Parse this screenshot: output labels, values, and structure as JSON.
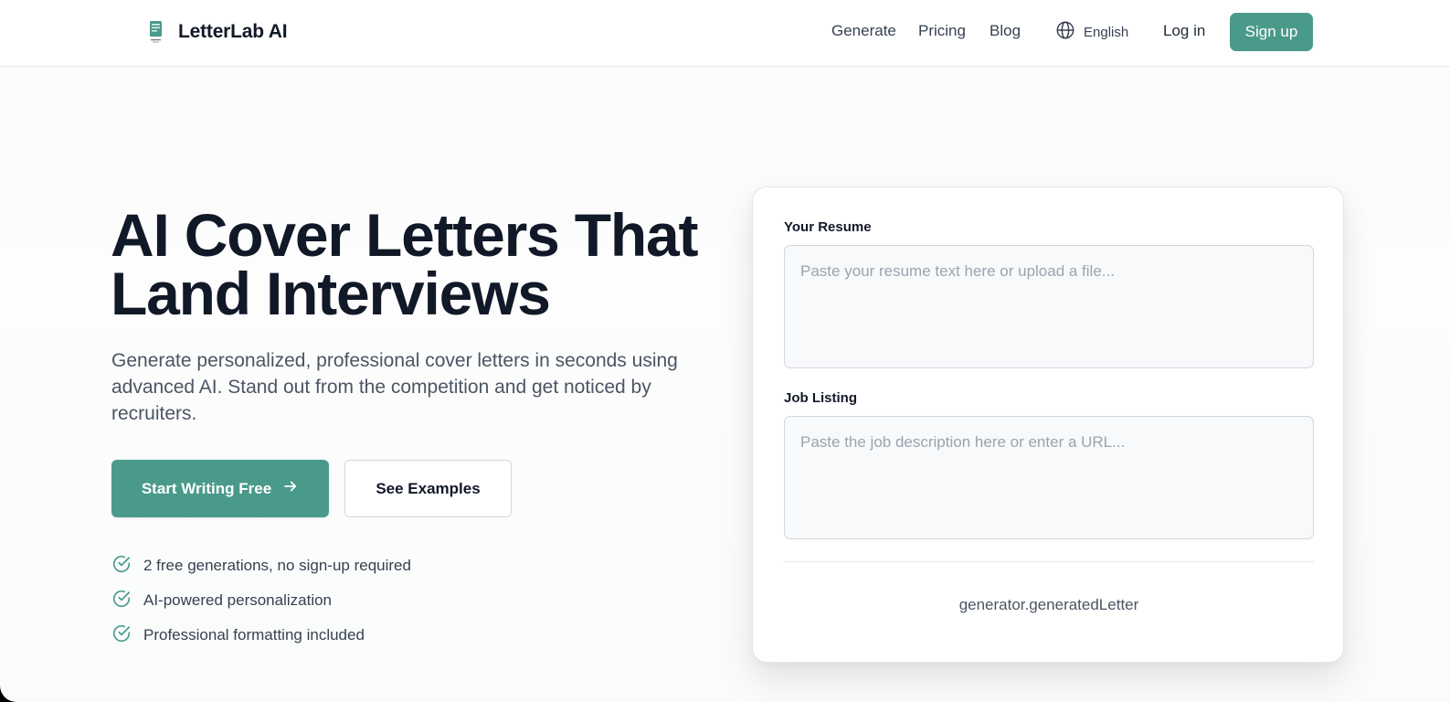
{
  "nav": {
    "brand": "LetterLab AI",
    "links": [
      "Generate",
      "Pricing",
      "Blog"
    ],
    "language": "English",
    "login_label": "Log in",
    "signup_label": "Sign up"
  },
  "hero": {
    "title_line1": "AI Cover Letters That",
    "title_line2": "Land Interviews",
    "subtitle": "Generate personalized, professional cover letters in seconds using advanced AI. Stand out from the competition and get noticed by recruiters.",
    "primary_cta": "Start Writing Free",
    "secondary_cta": "See Examples",
    "features": [
      "2 free generations, no sign-up required",
      "AI-powered personalization",
      "Professional formatting included"
    ]
  },
  "generator": {
    "resume_label": "Your Resume",
    "resume_placeholder": "Paste your resume text here or upload a file...",
    "resume_value": "",
    "job_label": "Job Listing",
    "job_placeholder": "Paste the job description here or enter a URL...",
    "job_value": "",
    "output_text": "generator.generatedLetter"
  },
  "colors": {
    "accent": "#4a9a8c",
    "text": "#111827",
    "muted": "#4b5563",
    "border": "#d1d5db"
  },
  "icons": {
    "brand": "letter-document-icon",
    "language": "globe-icon",
    "cta_arrow": "arrow-right-icon",
    "feature_check": "check-circle-icon"
  }
}
